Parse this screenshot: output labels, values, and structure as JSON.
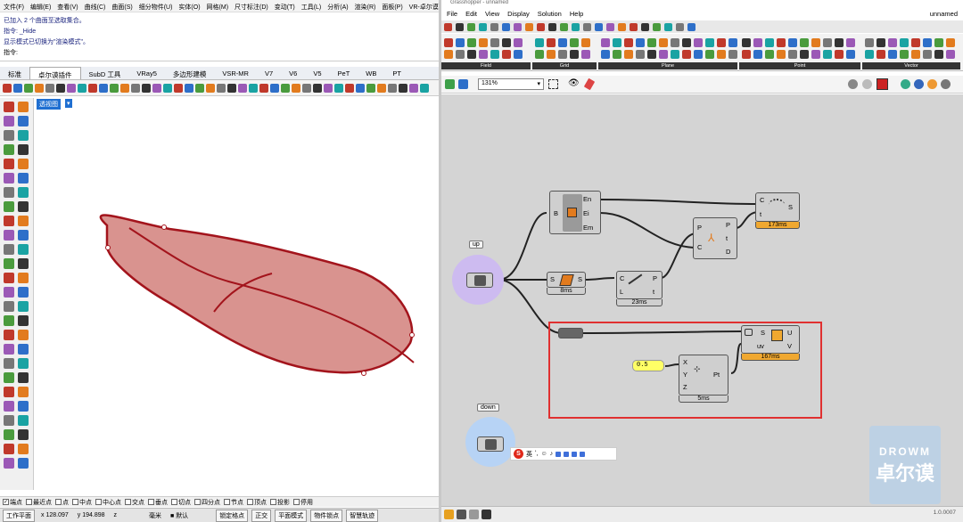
{
  "rhino": {
    "menu": [
      "文件(F)",
      "编辑(E)",
      "查看(V)",
      "曲线(C)",
      "曲面(S)",
      "细分物件(U)",
      "实体(O)",
      "网格(M)",
      "尺寸标注(D)",
      "变动(T)",
      "工具(L)",
      "分析(A)",
      "渲染(R)",
      "面板(P)",
      "VR-卓尔谟"
    ],
    "cmd_lines": [
      "已加入 2 个曲面至选取集合。",
      "指令: _Hide",
      "显示模式已切换为\"渲染模式\"。"
    ],
    "cmd_prompt": "指令:",
    "tabs": [
      "标准",
      "卓尔谟插件",
      "SubD 工具",
      "VRay5",
      "多边形建模",
      "VSR-MR",
      "V7",
      "V6",
      "V5",
      "PeT",
      "WB",
      "PT"
    ],
    "active_tab_index": 1,
    "viewport_label": "透视图",
    "osnaps": [
      {
        "label": "端点",
        "checked": true
      },
      {
        "label": "最近点",
        "checked": false
      },
      {
        "label": "点",
        "checked": false
      },
      {
        "label": "中点",
        "checked": false
      },
      {
        "label": "中心点",
        "checked": false
      },
      {
        "label": "交点",
        "checked": false
      },
      {
        "label": "垂点",
        "checked": false
      },
      {
        "label": "切点",
        "checked": false
      },
      {
        "label": "四分点",
        "checked": false
      },
      {
        "label": "节点",
        "checked": false
      },
      {
        "label": "顶点",
        "checked": false
      },
      {
        "label": "投影",
        "checked": false
      },
      {
        "label": "停用",
        "checked": false
      }
    ],
    "status": {
      "cplane": "工作平面",
      "x": "x 128.097",
      "y": "y 194.898",
      "z": "z",
      "unit": "毫米",
      "layer": "默认",
      "grid_snap": "锁定格点",
      "ortho": "正交",
      "planar": "平面模式",
      "osnap": "物件锁点",
      "smarttrack": "智慧轨迹"
    },
    "colors": {
      "shoe_fill": "#d9938f",
      "shoe_edge": "#a3141c"
    }
  },
  "gh": {
    "title": "Grasshopper - unnamed",
    "menu": [
      "File",
      "Edit",
      "View",
      "Display",
      "Solution",
      "Help"
    ],
    "doc_name": "unnamed",
    "ribbon_groups": [
      "Field",
      "Grid",
      "Plane",
      "Point",
      "Vector"
    ],
    "zoom": "131%",
    "version": "1.0.0007",
    "components": {
      "brep": {
        "in": "B",
        "outs": [
          "En",
          "Ei",
          "Em"
        ]
      },
      "srf": {
        "in": "S",
        "out": "S",
        "time": "8ms"
      },
      "pcurve": {
        "ins": [
          "C",
          "L"
        ],
        "outs": [
          "P",
          "t"
        ],
        "time": "23ms"
      },
      "cp": {
        "ins": [
          "P",
          "C"
        ],
        "outs": [
          "P",
          "t",
          "D"
        ]
      },
      "sub": {
        "ins": [
          "C",
          "t"
        ],
        "out": "S",
        "time": "173ms"
      },
      "eval": {
        "ins": [
          "S",
          "uv"
        ],
        "outs": [
          "U",
          "V"
        ],
        "time": "167ms"
      },
      "pt": {
        "ins": [
          "X",
          "Y",
          "Z"
        ],
        "out": "Pt",
        "time": "5ms"
      }
    },
    "slider_value": "0.5",
    "tags": {
      "up": "up",
      "down": "down"
    },
    "ime": {
      "lang": "英"
    },
    "watermark": {
      "line1": "DROWM",
      "line2": "卓尔谟"
    },
    "colors": {
      "bubble_up": "#cdbbf0",
      "bubble_down": "#b7d3f5",
      "highlight": "#e03030",
      "timer": "#f0a830"
    }
  }
}
